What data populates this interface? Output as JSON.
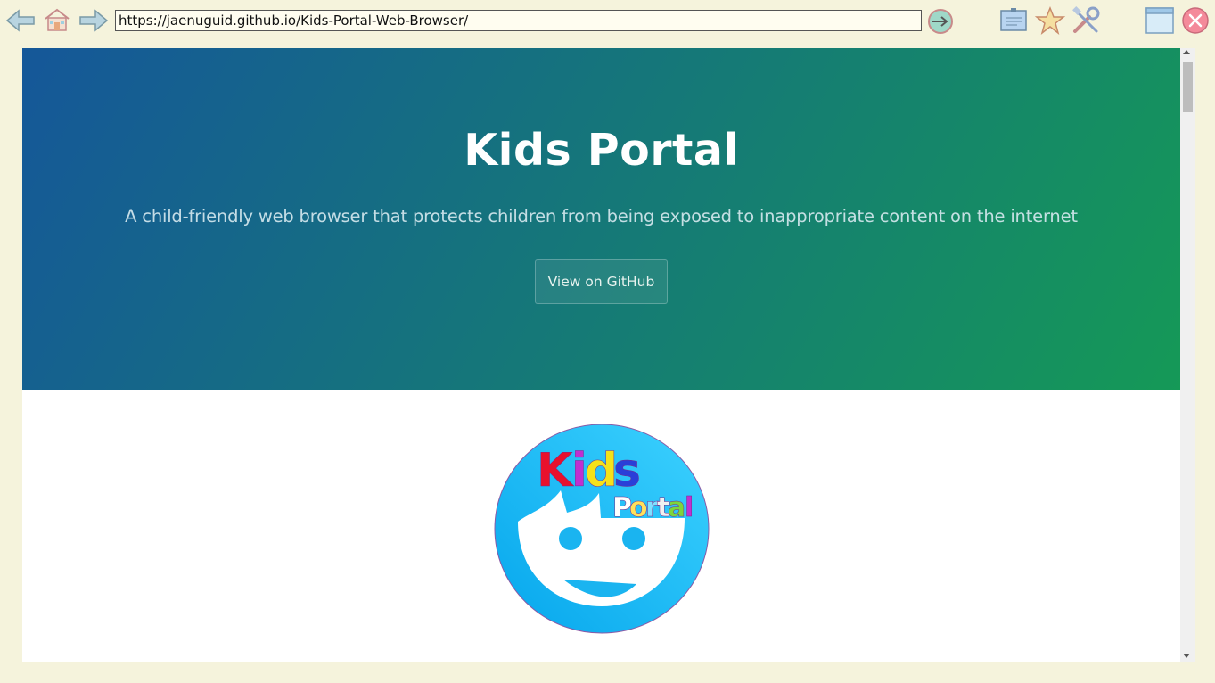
{
  "toolbar": {
    "url": "https://jaenuguid.github.io/Kids-Portal-Web-Browser/",
    "icons": [
      "back-icon",
      "home-icon",
      "forward-icon",
      "go-icon",
      "bookmarks-icon",
      "favorite-star-icon",
      "settings-tools-icon",
      "window-icon",
      "close-icon"
    ]
  },
  "hero": {
    "title": "Kids Portal",
    "subtitle": "A child-friendly web browser that protects children from being exposed to inappropriate content on the internet",
    "button_label": "View on GitHub",
    "gradient_colors": [
      "#155799",
      "#159957"
    ]
  },
  "logo": {
    "word1_letters": [
      "K",
      "i",
      "d",
      "s"
    ],
    "word1_colors": [
      "#e8112d",
      "#c030d0",
      "#f5e21a",
      "#2a3fd8"
    ],
    "word2_letters": [
      "P",
      "o",
      "r",
      "t",
      "a",
      "l"
    ],
    "word2_colors": [
      "#ffffff",
      "#ffe15a",
      "#7fe0ff",
      "#f0f0f0",
      "#7cd63b",
      "#c030d0"
    ],
    "circle_color": "#14b0ef"
  }
}
